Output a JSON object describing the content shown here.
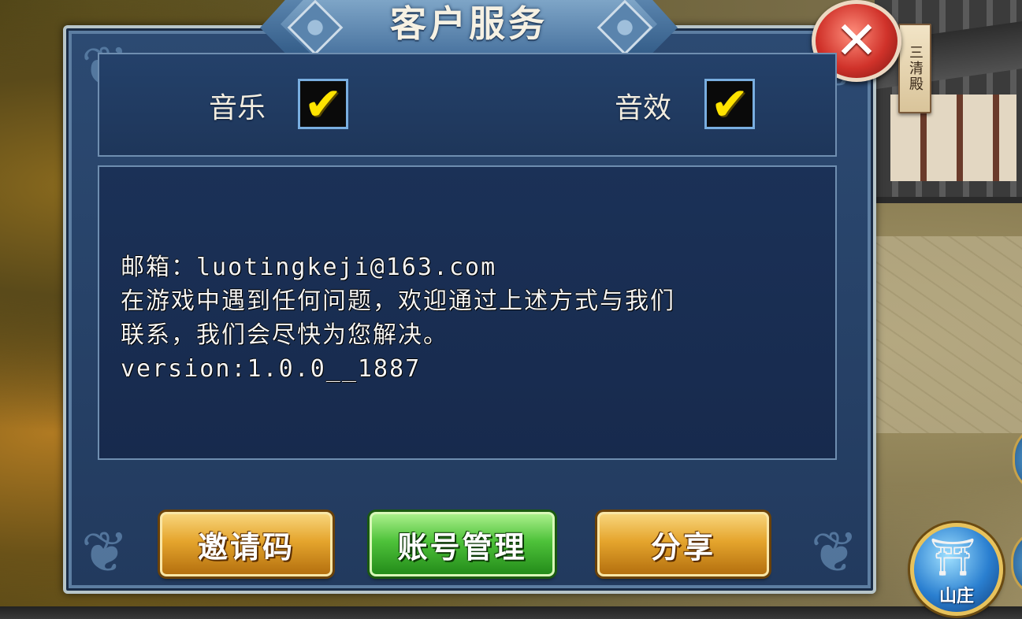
{
  "dialog": {
    "title": "客户服务",
    "close_icon": "close-x-icon",
    "sound": {
      "music_label": "音乐",
      "music_checked": true,
      "effects_label": "音效",
      "effects_checked": true,
      "check_glyph": "✔"
    },
    "info_lines": [
      "邮箱：luotingkeji@163.com",
      "在游戏中遇到任何问题，欢迎通过上述方式与我们",
      "联系，我们会尽快为您解决。",
      "version:1.0.0__1887"
    ],
    "buttons": {
      "invite_code": "邀请码",
      "account_management": "账号管理",
      "share": "分享"
    }
  },
  "hud": {
    "location_tag": "三清殿",
    "villa_button_label": "山庄",
    "villa_icon": "gate-icon"
  },
  "colors": {
    "accent_gold": "#e5a52d",
    "accent_green": "#4ec23a",
    "panel_blue": "#223a5e",
    "check_yellow": "#ffe300",
    "close_red": "#d0322a"
  }
}
